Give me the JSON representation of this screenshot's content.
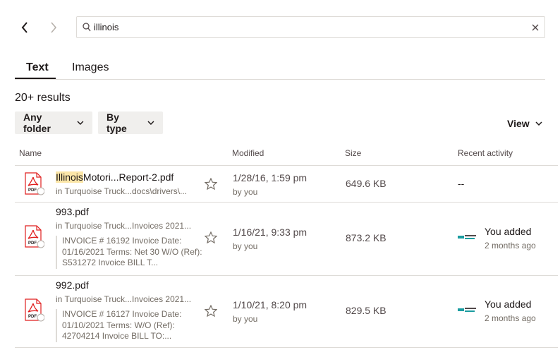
{
  "search": {
    "value": "illinois"
  },
  "tabs": [
    {
      "label": "Text",
      "active": true
    },
    {
      "label": "Images",
      "active": false
    }
  ],
  "results_count": "20+ results",
  "filters": {
    "folder": "Any folder",
    "type": "By type",
    "view": "View"
  },
  "columns": {
    "name": "Name",
    "modified": "Modified",
    "size": "Size",
    "activity": "Recent activity"
  },
  "colors": {
    "accent": "#1e1919",
    "pdf_red": "#e01f1f",
    "highlight": "#fbe6a8",
    "muted": "#736c64"
  },
  "rows": [
    {
      "name_highlight": "Illinois",
      "name_rest": "Motori...Report-2.pdf",
      "path": "in Turquoise Truck...docs\\drivers\\...",
      "modified": "1/28/16, 1:59 pm",
      "by": "by you",
      "size": "649.6 KB",
      "activity": "--"
    },
    {
      "name": "993.pdf",
      "path": "in Turquoise Truck...Invoices 2021...",
      "snippet": "INVOICE # 16192 Invoice Date: 01/16/2021 Terms: Net 30 W/O (Ref): S531272 Invoice BILL T...",
      "modified": "1/16/21, 9:33 pm",
      "by": "by you",
      "size": "873.2 KB",
      "activity": "You added",
      "activity_time": "2 months ago"
    },
    {
      "name": "992.pdf",
      "path": "in Turquoise Truck...Invoices 2021...",
      "snippet": "INVOICE # 16127 Invoice Date: 01/10/2021 Terms: W/O (Ref): 42704214 Invoice BILL TO:...",
      "modified": "1/10/21, 8:20 pm",
      "by": "by you",
      "size": "829.5 KB",
      "activity": "You added",
      "activity_time": "2 months ago"
    }
  ]
}
